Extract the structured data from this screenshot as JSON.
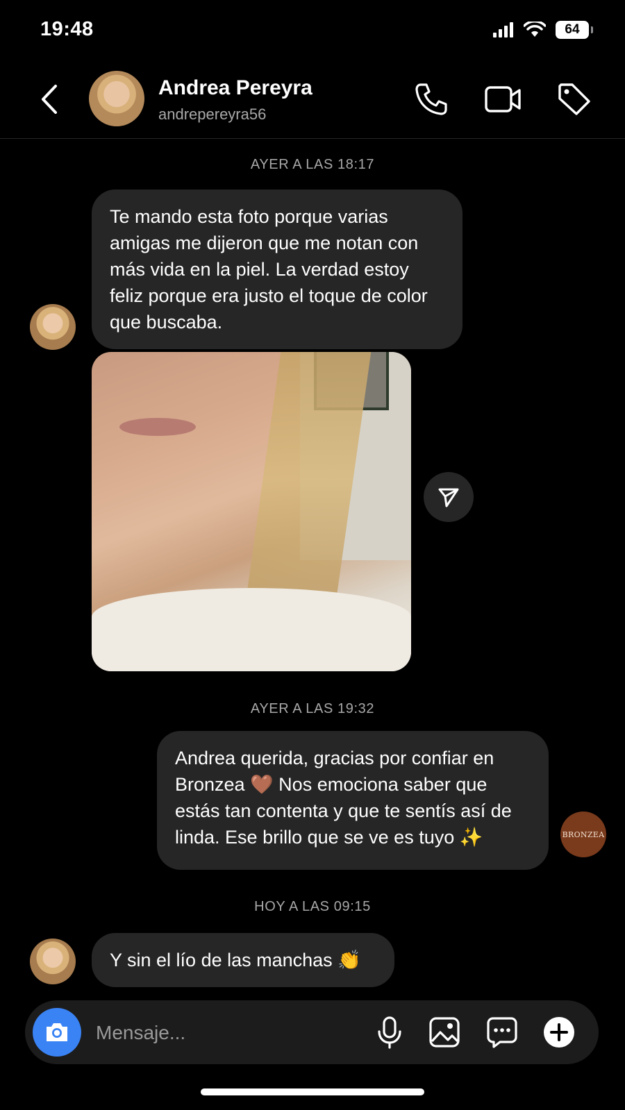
{
  "status_bar": {
    "time": "19:48",
    "battery": "64"
  },
  "header": {
    "name": "Andrea Pereyra",
    "handle": "andrepereyra56"
  },
  "thread": {
    "stamp1": "AYER A LAS 18:17",
    "msg1": "Te mando esta foto porque varias amigas me dijeron que me notan con más vida en la piel. La verdad estoy feliz porque era justo el toque de color que buscaba.",
    "stamp2": "AYER A LAS 19:32",
    "msg2": "Andrea querida, gracias por confiar en Bronzea 🤎 Nos emociona saber que estás tan contenta y que te sentís así de linda. Ese brillo que se ve es tuyo ✨",
    "bronzea_avatar": "BRONZEA",
    "stamp3": "HOY A LAS 09:15",
    "msg3": "Y sin el lío de las manchas 👏"
  },
  "composer": {
    "placeholder": "Mensaje..."
  },
  "icons": {
    "back": "chevron-left-icon",
    "call": "phone-icon",
    "video": "video-camera-icon",
    "tag": "tag-icon",
    "share": "paper-plane-icon",
    "camera": "camera-icon",
    "mic": "microphone-icon",
    "gallery": "image-icon",
    "sticker": "chat-bubble-icon",
    "add": "plus-circle-icon"
  }
}
